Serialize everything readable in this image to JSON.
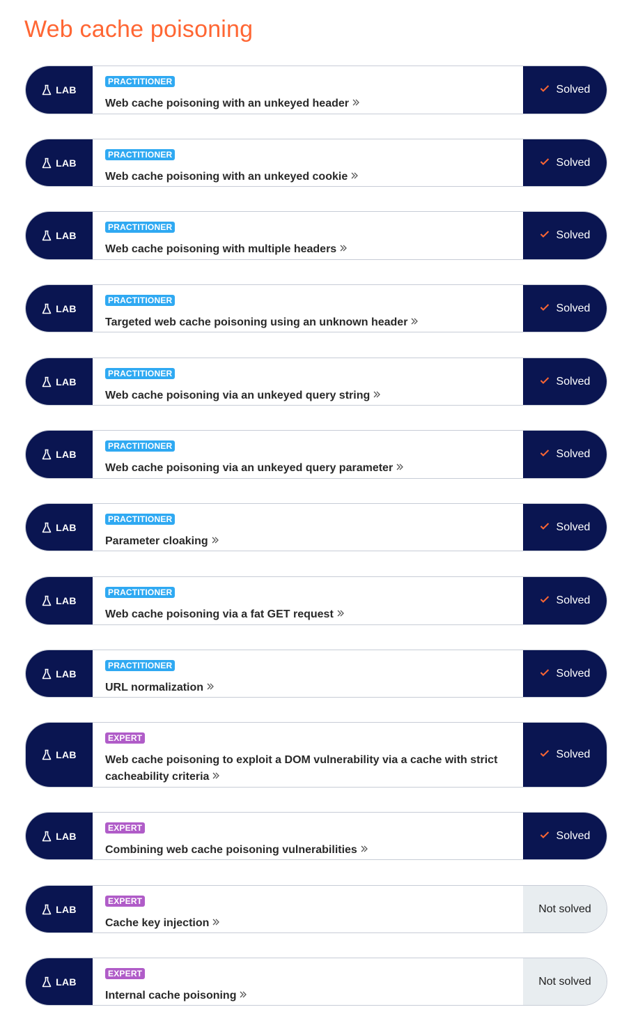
{
  "page": {
    "title": "Web cache poisoning"
  },
  "colors": {
    "accent": "#ff6633",
    "navy": "#0a1551",
    "practitioner": "#2fa9f2",
    "expert": "#b05cc8",
    "check": "#ff6633",
    "unsolved_bg": "#e8edf0"
  },
  "labs": [
    {
      "badge": "LAB",
      "level": "PRACTITIONER",
      "title": "Web cache poisoning with an unkeyed header",
      "status": "Solved"
    },
    {
      "badge": "LAB",
      "level": "PRACTITIONER",
      "title": "Web cache poisoning with an unkeyed cookie",
      "status": "Solved"
    },
    {
      "badge": "LAB",
      "level": "PRACTITIONER",
      "title": "Web cache poisoning with multiple headers",
      "status": "Solved"
    },
    {
      "badge": "LAB",
      "level": "PRACTITIONER",
      "title": "Targeted web cache poisoning using an unknown header",
      "status": "Solved"
    },
    {
      "badge": "LAB",
      "level": "PRACTITIONER",
      "title": "Web cache poisoning via an unkeyed query string",
      "status": "Solved"
    },
    {
      "badge": "LAB",
      "level": "PRACTITIONER",
      "title": "Web cache poisoning via an unkeyed query parameter",
      "status": "Solved"
    },
    {
      "badge": "LAB",
      "level": "PRACTITIONER",
      "title": "Parameter cloaking",
      "status": "Solved"
    },
    {
      "badge": "LAB",
      "level": "PRACTITIONER",
      "title": "Web cache poisoning via a fat GET request",
      "status": "Solved"
    },
    {
      "badge": "LAB",
      "level": "PRACTITIONER",
      "title": "URL normalization",
      "status": "Solved"
    },
    {
      "badge": "LAB",
      "level": "EXPERT",
      "title": "Web cache poisoning to exploit a DOM vulnerability via a cache with strict cacheability criteria",
      "status": "Solved"
    },
    {
      "badge": "LAB",
      "level": "EXPERT",
      "title": "Combining web cache poisoning vulnerabilities",
      "status": "Solved"
    },
    {
      "badge": "LAB",
      "level": "EXPERT",
      "title": "Cache key injection",
      "status": "Not solved"
    },
    {
      "badge": "LAB",
      "level": "EXPERT",
      "title": "Internal cache poisoning",
      "status": "Not solved"
    }
  ]
}
